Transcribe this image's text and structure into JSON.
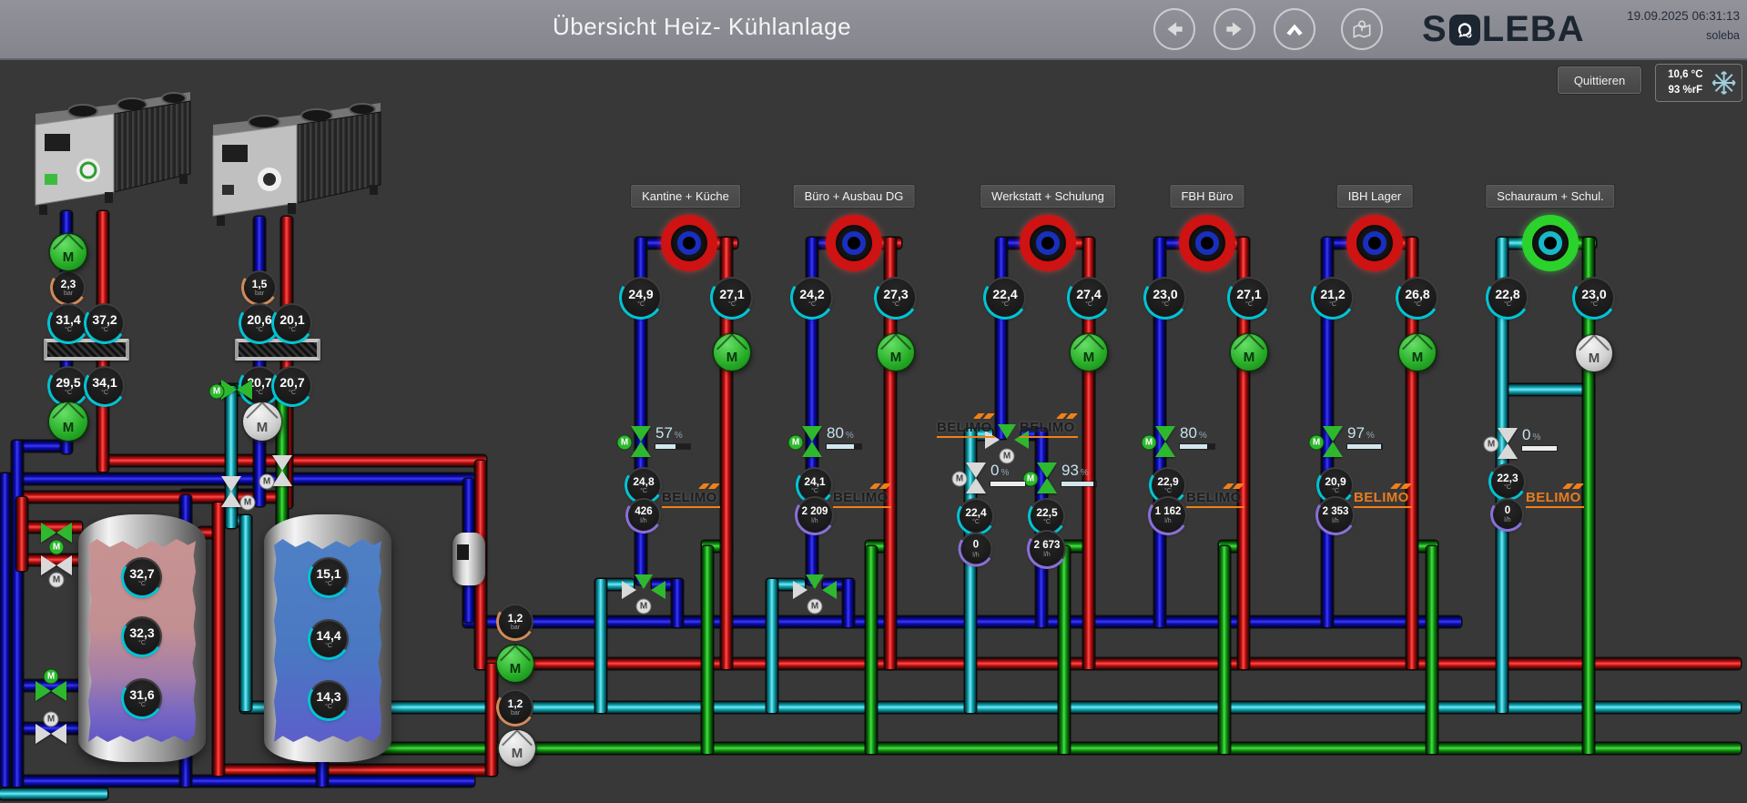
{
  "header": {
    "title": "Übersicht Heiz- Kühlanlage",
    "logo_prefix": "S",
    "logo_suffix": "LEBA",
    "datetime": "19.09.2025 06:31:13",
    "user": "soleba"
  },
  "toolbar": {
    "ack_button": "Quittieren",
    "outdoor_temp": "10,6 °C",
    "outdoor_humidity": "93 %rF"
  },
  "labels": {
    "motor": "M"
  },
  "brand_valve": "BELIMO",
  "units": {
    "temp": "°C",
    "pressure": "bar",
    "flow": "l/h",
    "percent": "%"
  },
  "chiller1": {
    "pressure": "2,3",
    "t_in_top": "31,4",
    "t_out_top": "37,2",
    "t_in_bottom": "29,5",
    "t_out_bottom": "34,1"
  },
  "chiller2": {
    "pressure": "1,5",
    "t_in_top": "20,6",
    "t_out_top": "20,1",
    "t_in_bottom": "20,7",
    "t_out_bottom": "20,7"
  },
  "tank_warm": {
    "top": "32,7",
    "middle": "32,3",
    "bottom": "31,6"
  },
  "tank_cold": {
    "top": "15,1",
    "middle": "14,4",
    "bottom": "14,3"
  },
  "distribution": {
    "pressure_heating": "1,2",
    "pressure_cooling": "1,2"
  },
  "zones": [
    {
      "name": "Kantine + Küche",
      "temp_supply": "24,9",
      "temp_return": "27,1",
      "valve_pct": "57",
      "bar_pct": 57,
      "temp_mixed": "24,8",
      "flow": "426"
    },
    {
      "name": "Büro + Ausbau DG",
      "temp_supply": "24,2",
      "temp_return": "27,3",
      "valve_pct": "80",
      "bar_pct": 80,
      "temp_mixed": "24,1",
      "flow": "2 209"
    },
    {
      "name": "Werkstatt + Schulung",
      "temp_supply": "22,4",
      "temp_return": "27,4",
      "branch_a": {
        "valve_pct": "0",
        "bar_pct": 100,
        "temp": "22,4",
        "flow": "0"
      },
      "branch_b": {
        "valve_pct": "93",
        "bar_pct": 93,
        "temp": "22,5",
        "flow": "2 673"
      }
    },
    {
      "name": "FBH Büro",
      "temp_supply": "23,0",
      "temp_return": "27,1",
      "valve_pct": "80",
      "bar_pct": 80,
      "temp_mixed": "22,9",
      "flow": "1 162"
    },
    {
      "name": "IBH Lager",
      "temp_supply": "21,2",
      "temp_return": "26,8",
      "valve_pct": "97",
      "bar_pct": 97,
      "temp_mixed": "20,9",
      "flow": "2 353"
    },
    {
      "name": "Schauraum + Schul.",
      "temp_supply": "22,8",
      "temp_return": "23,0",
      "valve_pct": "0",
      "bar_pct": 100,
      "temp_mixed": "22,3",
      "flow": "0"
    }
  ],
  "colors": {
    "pipe_hot": "#cc1111",
    "pipe_cold": "#1111bb",
    "pipe_cooling": "#18b8c8",
    "pipe_source": "#22bb22",
    "valve_open": "#2eb82e",
    "belimo_orange": "#f08018",
    "arc_temp": "#00c4d4",
    "arc_flow": "#8a6fd8",
    "arc_pressure": "#d08a5a"
  }
}
